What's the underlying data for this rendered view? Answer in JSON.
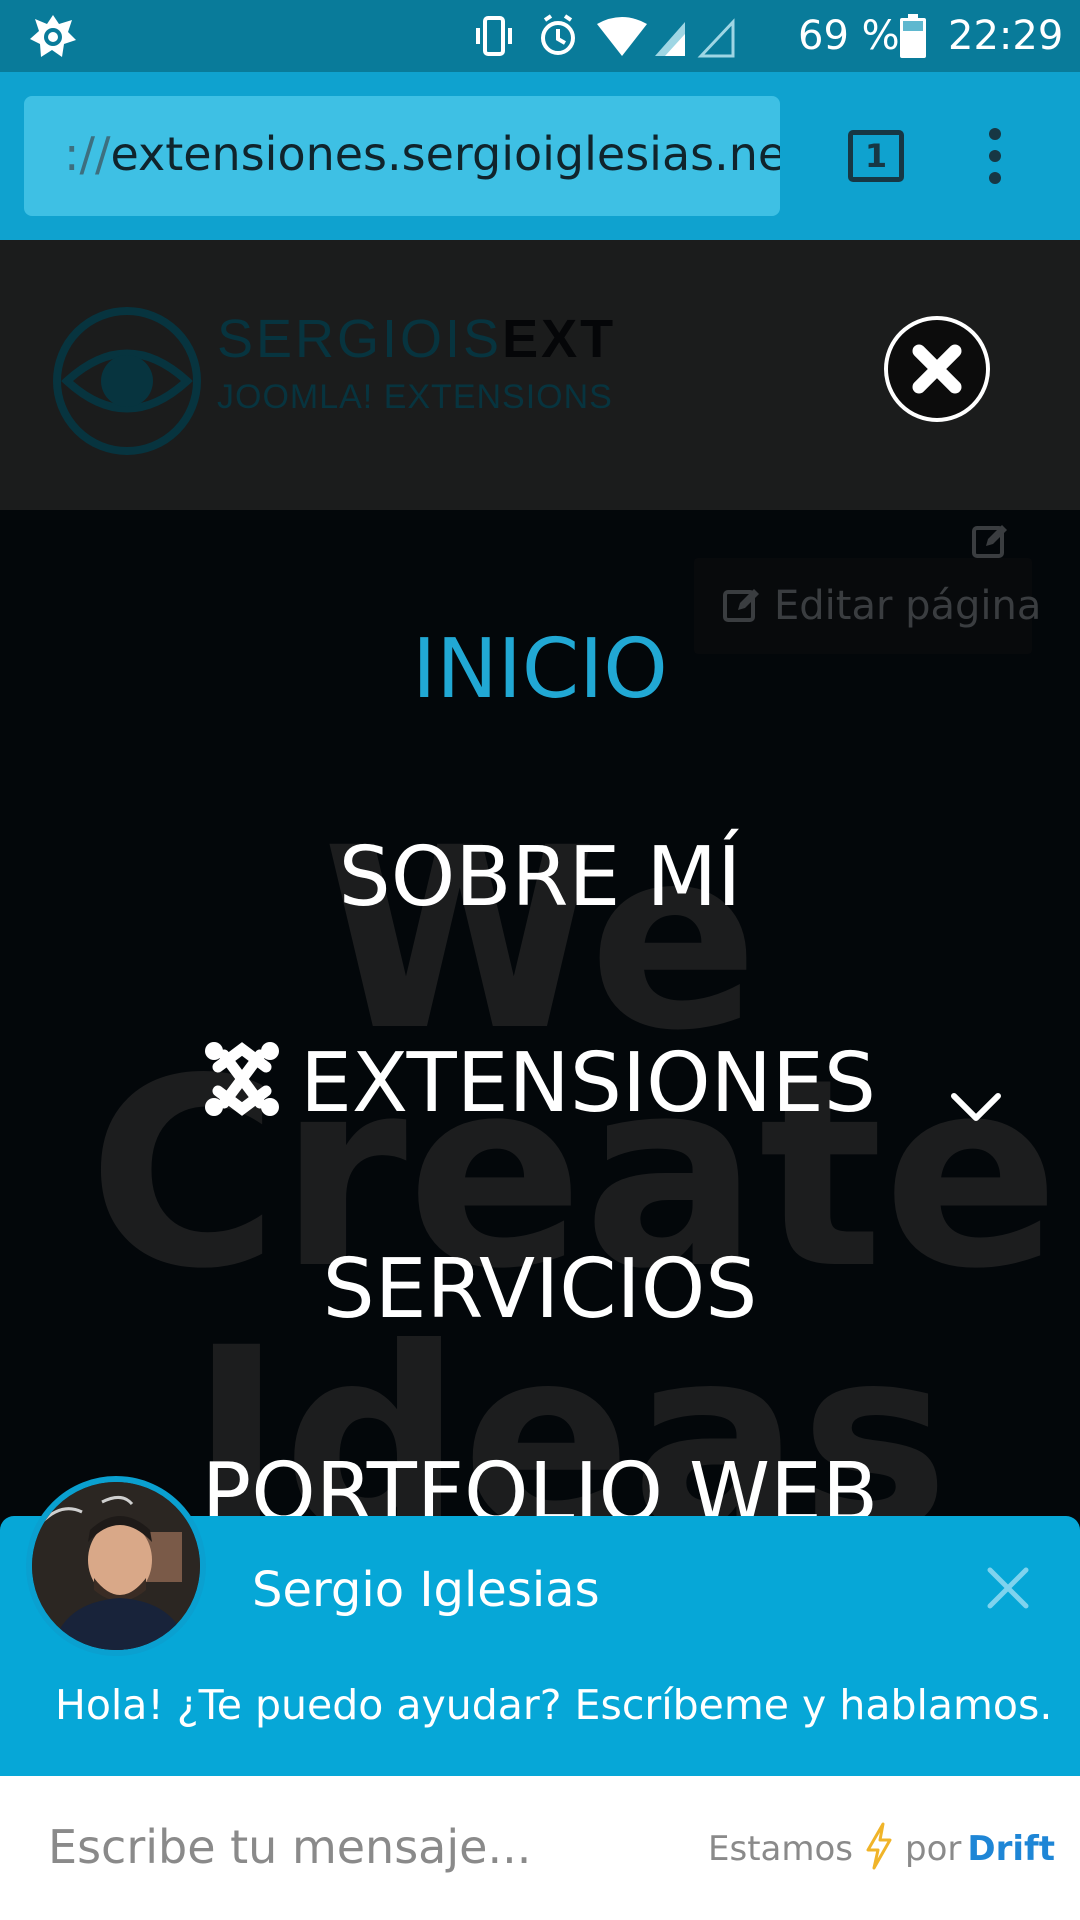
{
  "status_bar": {
    "battery_percent": "69 %",
    "time": "22:29",
    "icons": [
      "avast-icon",
      "vibrate-icon",
      "alarm-icon",
      "wifi-icon",
      "signal-icon",
      "signal-empty-icon",
      "battery-icon"
    ]
  },
  "browser": {
    "url_scheme": "://",
    "url_host": "extensiones.sergioiglesias.net",
    "tab_count": "1"
  },
  "site": {
    "logo_brand_light": "SERGIOIS",
    "logo_brand_bold": "EXT",
    "logo_tagline": "JOOMLA! EXTENSIONS",
    "edit_page_label": "Editar página"
  },
  "background_words": [
    "We",
    "Create",
    "Ideas"
  ],
  "nav": {
    "inicio": "INICIO",
    "sobre": "SOBRE MÍ",
    "extensiones": "EXTENSIONES",
    "servicios": "SERVICIOS",
    "portfolio": "PORTFOLIO WEB"
  },
  "chat": {
    "agent_name": "Sergio Iglesias",
    "greeting": "Hola! ¿Te puedo ayudar? Escríbeme y hablamos.",
    "input_placeholder": "Escribe tu mensaje...",
    "powered_prefix": "Estamos",
    "powered_by": "por",
    "powered_brand": "Drift"
  },
  "colors": {
    "status_bar": "#097b9a",
    "browser_bar": "#0fa2cf",
    "url_box": "#3ec0e4",
    "active_nav": "#21a8d4",
    "chat_header": "#06a7d7",
    "drift_brand": "#1e86d6"
  }
}
